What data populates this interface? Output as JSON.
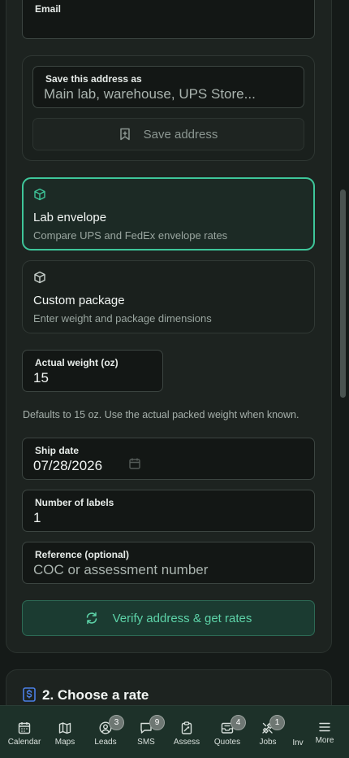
{
  "form": {
    "email": {
      "label": "Email"
    },
    "save_address": {
      "label": "Save this address as",
      "placeholder": "Main lab, warehouse, UPS Store...",
      "button_label": "Save address"
    },
    "package_options": [
      {
        "title": "Lab envelope",
        "subtitle": "Compare UPS and FedEx envelope rates",
        "selected": true,
        "icon": "package-icon"
      },
      {
        "title": "Custom package",
        "subtitle": "Enter weight and package dimensions",
        "selected": false,
        "icon": "package-icon"
      }
    ],
    "weight": {
      "label": "Actual weight (oz)",
      "value": "15"
    },
    "weight_helper": "Defaults to 15 oz. Use the actual packed weight when known.",
    "ship_date": {
      "label": "Ship date",
      "value": "07/28/2026",
      "icon": "calendar-icon"
    },
    "num_labels": {
      "label": "Number of labels",
      "value": "1"
    },
    "reference": {
      "label": "Reference (optional)",
      "placeholder": "COC or assessment number"
    },
    "verify_button_label": "Verify address & get rates"
  },
  "section2": {
    "title": "2. Choose a rate",
    "icon": "dollar-icon"
  },
  "tabbar": {
    "tabs": [
      {
        "label": "Calendar",
        "icon": "calendar-icon",
        "badge": null
      },
      {
        "label": "Maps",
        "icon": "map-icon",
        "badge": null
      },
      {
        "label": "Leads",
        "icon": "user-circle-icon",
        "badge": "3"
      },
      {
        "label": "SMS",
        "icon": "chat-icon",
        "badge": "9"
      },
      {
        "label": "Assess",
        "icon": "clipboard-icon",
        "badge": null
      },
      {
        "label": "Quotes",
        "icon": "inbox-icon",
        "badge": "4"
      },
      {
        "label": "Jobs",
        "icon": "tools-icon",
        "badge": "1"
      },
      {
        "label": "Inv",
        "icon": null,
        "badge": null
      },
      {
        "label": "More",
        "icon": "menu-icon",
        "badge": null
      }
    ]
  },
  "colors": {
    "accent": "#3ec69a",
    "background": "#151a18",
    "tabbar": "#1d3129"
  }
}
